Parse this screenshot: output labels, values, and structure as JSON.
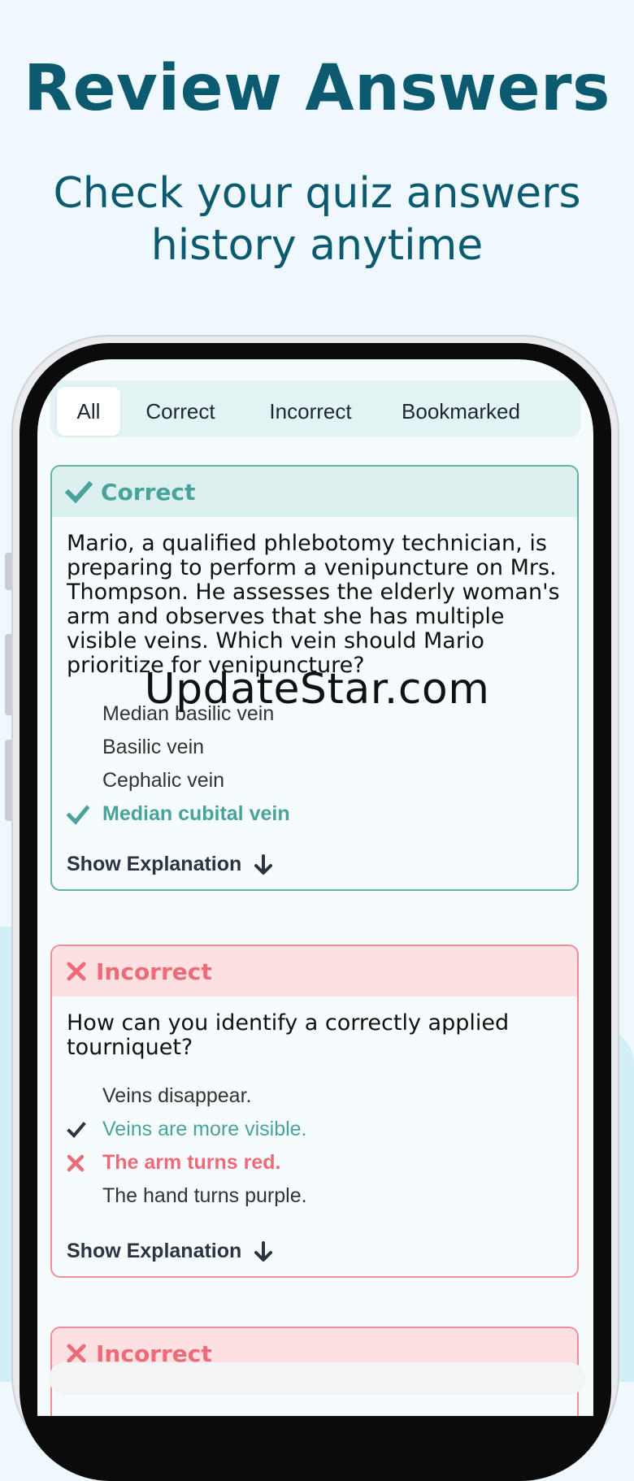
{
  "headline": "Review Answers",
  "subline": {
    "line1": "Check your quiz answers",
    "line2": "history anytime"
  },
  "tabs": [
    {
      "label": "All",
      "active": true
    },
    {
      "label": "Correct",
      "active": false
    },
    {
      "label": "Incorrect",
      "active": false
    },
    {
      "label": "Bookmarked",
      "active": false
    }
  ],
  "cards": [
    {
      "status": "Correct",
      "question": "Mario, a qualified phlebotomy technician, is preparing to perform a venipuncture on Mrs. Thompson. He assesses the elderly woman's arm and observes that she has multiple visible veins. Which vein should Mario prioritize for venipuncture?",
      "answers": [
        {
          "text": "Median basilic vein",
          "state": "none"
        },
        {
          "text": "Basilic vein",
          "state": "none"
        },
        {
          "text": "Cephalic vein",
          "state": "none"
        },
        {
          "text": "Median cubital vein",
          "state": "selected-correct"
        }
      ],
      "explain_label": "Show Explanation"
    },
    {
      "status": "Incorrect",
      "question": "How can you identify a correctly applied tourniquet?",
      "answers": [
        {
          "text": "Veins disappear.",
          "state": "none"
        },
        {
          "text": "Veins are more visible.",
          "state": "correct"
        },
        {
          "text": "The arm turns red.",
          "state": "selected-wrong"
        },
        {
          "text": "The hand turns purple.",
          "state": "none"
        }
      ],
      "explain_label": "Show Explanation"
    },
    {
      "status": "Incorrect"
    }
  ],
  "watermark": "UpdateStar.com",
  "colors": {
    "correct": "#4aa39a",
    "incorrect": "#ec6b78",
    "brand": "#0c5a6f"
  }
}
